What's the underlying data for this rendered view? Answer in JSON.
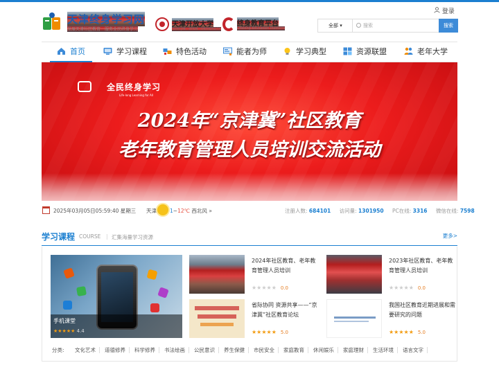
{
  "header": {
    "login_label": "登录",
    "logo_main": {
      "title": "天津终身学习网",
      "slogan": "发展天津社区教育　服务全民终身学习"
    },
    "logo_uni": {
      "title": "天津开放大学",
      "subtitle": "TIAN JIN　OPEN　UNIVERSITY"
    },
    "logo_platform": {
      "title": "终身教育平台",
      "subtitle": "Lifelong Education Platform"
    },
    "search": {
      "category": "全部",
      "placeholder": "搜索",
      "button": "搜索"
    }
  },
  "nav": {
    "items": [
      {
        "label": "首页",
        "icon": "home-icon",
        "active": true
      },
      {
        "label": "学习课程",
        "icon": "monitor-icon"
      },
      {
        "label": "特色活动",
        "icon": "activity-icon"
      },
      {
        "label": "能者为师",
        "icon": "teacher-icon"
      },
      {
        "label": "学习典型",
        "icon": "bulb-icon"
      },
      {
        "label": "资源联盟",
        "icon": "grid-icon"
      },
      {
        "label": "老年大学",
        "icon": "elder-icon"
      }
    ]
  },
  "banner": {
    "brand": "全民终身学习",
    "brand_en": "Life-long Learning for All",
    "line1": "2024年“京津冀”社区教育",
    "line2": "老年教育管理人员培训交流活动"
  },
  "infobar": {
    "datetime": "2025年03月05日05:59:40 星期三",
    "city": "天津",
    "temp_low": "1",
    "temp_sep": "~",
    "temp_high": "12℃",
    "wind": "西北风",
    "wind_arrow": "»",
    "stats": [
      {
        "label": "注册人数:",
        "value": "684101"
      },
      {
        "label": "访问量:",
        "value": "1301950"
      },
      {
        "label": "PC在线:",
        "value": "3316"
      },
      {
        "label": "微信在线:",
        "value": "7598"
      }
    ]
  },
  "courses_section": {
    "title": "学习课程",
    "title_en": "COURSE",
    "separator": "|",
    "subtitle": "汇集海量学习资源",
    "more": "更多>",
    "feature": {
      "title": "手机课堂",
      "stars": "★★★★★",
      "score": "4.4"
    },
    "cards": [
      {
        "title": "2024年社区教育、老年教育管理人员培训",
        "stars": "★★★★★",
        "score": "0.0",
        "rated": false
      },
      {
        "title": "2023年社区教育、老年教育管理人员培训",
        "stars": "★★★★★",
        "score": "0.0",
        "rated": false
      },
      {
        "title": "省际协同 资源共享——“京津冀”社区教育论坛",
        "stars": "★★★★★",
        "score": "5.0",
        "rated": true
      },
      {
        "title": "我国社区教育近期进展和需要研究的问题",
        "stars": "★★★★★",
        "score": "5.0",
        "rated": true
      }
    ],
    "categories_label": "分类:",
    "categories": [
      "文化艺术",
      "道德修养",
      "科学修养",
      "书法绘画",
      "公民意识",
      "养生保健",
      "市民安全",
      "家庭教育",
      "休闲娱乐",
      "家庭理财",
      "生活环境",
      "语言文字"
    ]
  },
  "colors": {
    "accent": "#1b7fd0",
    "banner_red": "#ec1c1c",
    "star": "#f39c12"
  }
}
